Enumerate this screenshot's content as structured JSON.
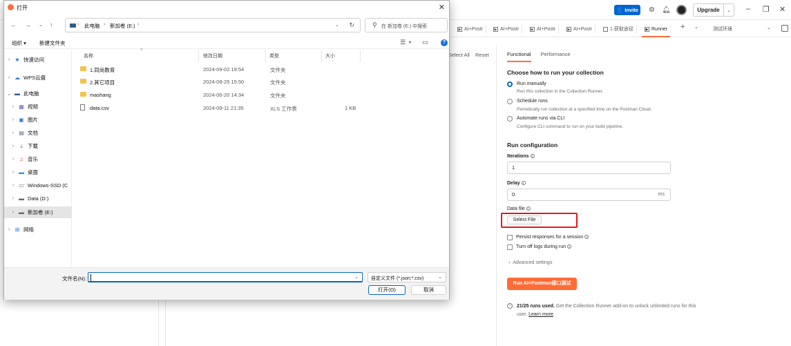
{
  "postman": {
    "invite_label": "Invite",
    "upgrade_label": "Upgrade",
    "tabs": [
      {
        "label": "AI+Postr"
      },
      {
        "label": "AI+Postr"
      },
      {
        "label": "AI+Postr"
      },
      {
        "label": "AI+Postr"
      },
      {
        "label": "1.获取途径"
      },
      {
        "label": "Runner"
      }
    ],
    "env_label": "测试环境",
    "select_all": "Select All",
    "reset": "Reset",
    "subtabs": {
      "functional": "Functional",
      "performance": "Performance"
    },
    "choose_heading": "Choose how to run your collection",
    "options": [
      {
        "title": "Run manually",
        "desc": "Run this collection in the Collection Runner."
      },
      {
        "title": "Schedule runs",
        "desc": "Periodically run collection at a specified time on the Postman Cloud."
      },
      {
        "title": "Automate runs via CLI",
        "desc": "Configure CLI command to run on your build pipeline."
      }
    ],
    "run_config_heading": "Run configuration",
    "iterations_label": "Iterations",
    "iterations_value": "1",
    "delay_label": "Delay",
    "delay_value": "0",
    "delay_unit": "ms",
    "data_file_label": "Data file",
    "select_file_label": "Select File",
    "persist_label": "Persist responses for a session",
    "turn_off_logs_label": "Turn off logs during run",
    "advanced_label": "Advanced settings",
    "run_button_label": "Run AI+Postman接口测试",
    "usage_bold": "21/25 runs used.",
    "usage_text": " Get the Collection Runner add-on to unlock unlimited runs for this user. ",
    "usage_link": "Learn more",
    "usage_end": "."
  },
  "dialog": {
    "title": "打开",
    "breadcrumb": [
      "此电脑",
      "新加卷 (E:)"
    ],
    "search_placeholder": "在 新加卷 (E:) 中搜索",
    "toolbar": {
      "organize": "组织 ▾",
      "new_folder": "新建文件夹"
    },
    "sidebar": [
      {
        "label": "快速访问"
      },
      {
        "label": "WPS云盘"
      },
      {
        "label": "此电脑"
      },
      {
        "label": "视频"
      },
      {
        "label": "图片"
      },
      {
        "label": "文档"
      },
      {
        "label": "下载"
      },
      {
        "label": "音乐"
      },
      {
        "label": "桌面"
      },
      {
        "label": "Windows-SSD (C"
      },
      {
        "label": "Data (D:)"
      },
      {
        "label": "新加卷 (E:)"
      },
      {
        "label": "网络"
      }
    ],
    "columns": {
      "name": "名称",
      "date": "修改日期",
      "type": "类型",
      "size": "大小"
    },
    "files": [
      {
        "name": "1.同尚教育",
        "date": "2024-09-02 19:54",
        "type": "文件夹",
        "size": ""
      },
      {
        "name": "2.其它项目",
        "date": "2024-08-25 15:50",
        "type": "文件夹",
        "size": ""
      },
      {
        "name": "mashang",
        "date": "2024-06-20 14:34",
        "type": "文件夹",
        "size": ""
      },
      {
        "name": "data.csv",
        "date": "2024-09-11 21:35",
        "type": "XLS 工作表",
        "size": "1 KB"
      }
    ],
    "filename_label": "文件名(N):",
    "filename_value": "",
    "filter_label": "自定义文件 (*.json;*.csv)",
    "open_label": "打开(O)",
    "cancel_label": "取消"
  }
}
